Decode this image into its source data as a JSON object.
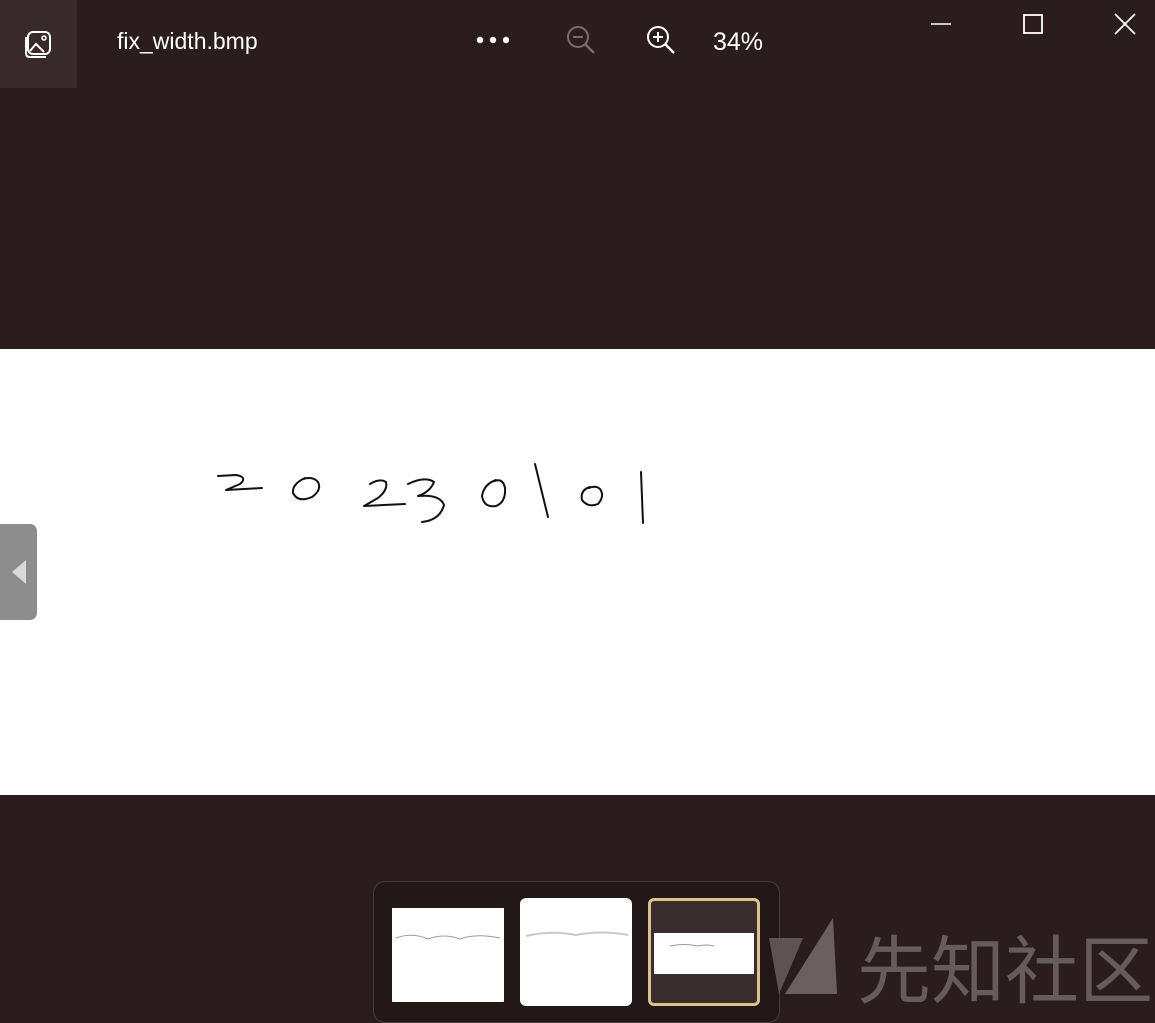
{
  "titlebar": {
    "file_name": "fix_width.bmp",
    "zoom_level": "34%",
    "icons": {
      "app": "photo-gallery-icon",
      "more": "more-horizontal-icon",
      "zoom_out": "zoom-out-icon",
      "zoom_in": "zoom-in-icon",
      "minimize": "minimize-icon",
      "maximize": "maximize-icon",
      "close": "close-icon"
    }
  },
  "image": {
    "content": "handwritten digits drawing",
    "background": "#ffffff"
  },
  "navigation": {
    "prev_icon": "chevron-left-icon"
  },
  "filmstrip": {
    "thumbnails": [
      {
        "selected": false
      },
      {
        "selected": false
      },
      {
        "selected": true
      }
    ],
    "selected_color": "#dcc38d"
  },
  "watermark": {
    "text": "先知社区"
  },
  "colors": {
    "window_bg": "#2b1d1d",
    "app_icon_bg": "#382a2a",
    "prev_button": "#8d8d8d"
  }
}
